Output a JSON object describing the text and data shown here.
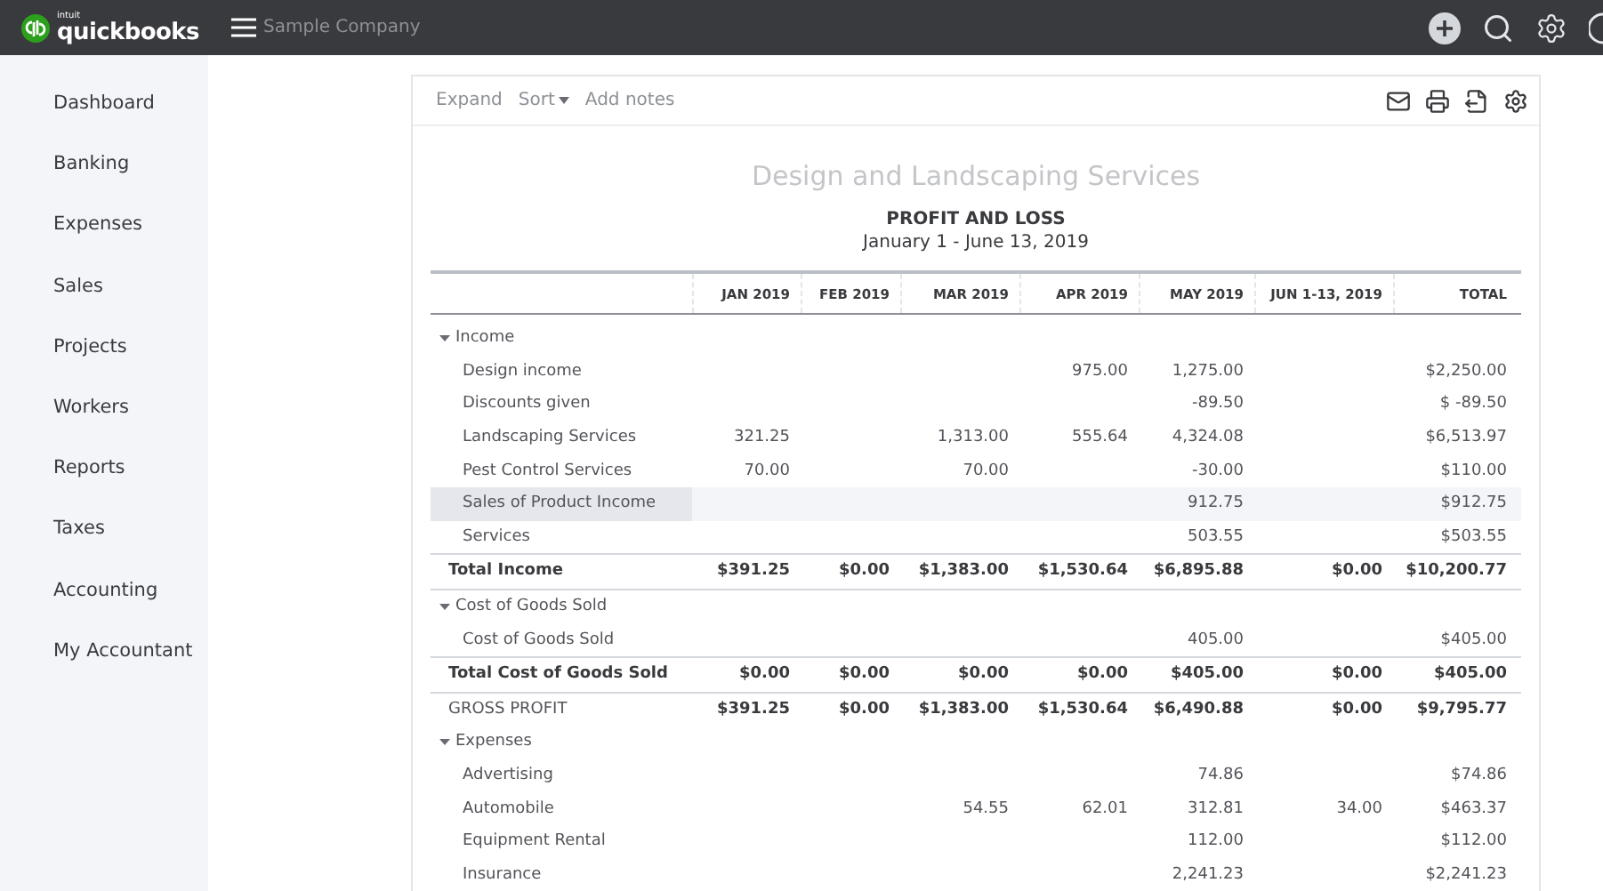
{
  "header": {
    "logo_small": "intuit",
    "logo": "quickbooks",
    "company": "Sample Company"
  },
  "sidebar": {
    "items": [
      {
        "label": "Dashboard",
        "selected": false
      },
      {
        "label": "Banking",
        "selected": false
      },
      {
        "label": "Expenses",
        "selected": false
      },
      {
        "label": "Sales",
        "selected": false
      },
      {
        "label": "Projects",
        "selected": false
      },
      {
        "label": "Workers",
        "selected": false
      },
      {
        "label": "Reports",
        "selected": false
      },
      {
        "label": "Taxes",
        "selected": false
      },
      {
        "label": "Accounting",
        "selected": false
      },
      {
        "label": "My Accountant",
        "selected": false
      }
    ]
  },
  "toolbar": {
    "expand": "Expand",
    "sort": "Sort",
    "add_notes": "Add notes"
  },
  "report": {
    "company": "Design and Landscaping Services",
    "title": "PROFIT AND LOSS",
    "period": "January 1 - June 13, 2019",
    "columns": [
      "JAN 2019",
      "FEB 2019",
      "MAR 2019",
      "APR 2019",
      "MAY 2019",
      "JUN 1-13, 2019",
      "TOTAL"
    ],
    "rows": [
      {
        "kind": "section",
        "label": "Income",
        "expanded": true
      },
      {
        "kind": "item",
        "label": "Design income",
        "values": {
          "3": "975.00",
          "4": "1,275.00",
          "6": "$2,250.00"
        },
        "highlighted": false
      },
      {
        "kind": "item",
        "label": "Discounts given",
        "values": {
          "4": "-89.50",
          "6": "$ -89.50"
        },
        "highlighted": false
      },
      {
        "kind": "item",
        "label": "Landscaping Services",
        "values": {
          "0": "321.25",
          "2": "1,313.00",
          "3": "555.64",
          "4": "4,324.08",
          "6": "$6,513.97"
        },
        "highlighted": false
      },
      {
        "kind": "item",
        "label": "Pest Control Services",
        "values": {
          "0": "70.00",
          "2": "70.00",
          "4": "-30.00",
          "6": "$110.00"
        },
        "highlighted": false
      },
      {
        "kind": "item",
        "label": "Sales of Product Income",
        "values": {
          "4": "912.75",
          "6": "$912.75"
        },
        "highlighted": true
      },
      {
        "kind": "item",
        "label": "Services",
        "values": {
          "4": "503.55",
          "6": "$503.55"
        },
        "highlighted": false
      },
      {
        "kind": "total",
        "label": "Total Income",
        "values": {
          "0": "$391.25",
          "1": "$0.00",
          "2": "$1,383.00",
          "3": "$1,530.64",
          "4": "$6,895.88",
          "5": "$0.00",
          "6": "$10,200.77"
        },
        "highlighted": false
      },
      {
        "kind": "section",
        "label": "Cost of Goods Sold",
        "expanded": true
      },
      {
        "kind": "item",
        "label": "Cost of Goods Sold",
        "values": {
          "4": "405.00",
          "6": "$405.00"
        },
        "highlighted": false
      },
      {
        "kind": "total",
        "label": "Total Cost of Goods Sold",
        "values": {
          "0": "$0.00",
          "1": "$0.00",
          "2": "$0.00",
          "3": "$0.00",
          "4": "$405.00",
          "5": "$0.00",
          "6": "$405.00"
        },
        "highlighted": false
      },
      {
        "kind": "gross",
        "label": "GROSS PROFIT",
        "values": {
          "0": "$391.25",
          "1": "$0.00",
          "2": "$1,383.00",
          "3": "$1,530.64",
          "4": "$6,490.88",
          "5": "$0.00",
          "6": "$9,795.77"
        },
        "highlighted": false
      },
      {
        "kind": "section",
        "label": "Expenses",
        "expanded": true
      },
      {
        "kind": "item",
        "label": "Advertising",
        "values": {
          "4": "74.86",
          "6": "$74.86"
        },
        "highlighted": false
      },
      {
        "kind": "item",
        "label": "Automobile",
        "values": {
          "2": "54.55",
          "3": "62.01",
          "4": "312.81",
          "5": "34.00",
          "6": "$463.37"
        },
        "highlighted": false
      },
      {
        "kind": "item",
        "label": "Equipment Rental",
        "values": {
          "4": "112.00",
          "6": "$112.00"
        },
        "highlighted": false
      },
      {
        "kind": "item",
        "label": "Insurance",
        "values": {
          "4": "2,241.23",
          "6": "$2,241.23"
        },
        "highlighted": false
      }
    ]
  }
}
